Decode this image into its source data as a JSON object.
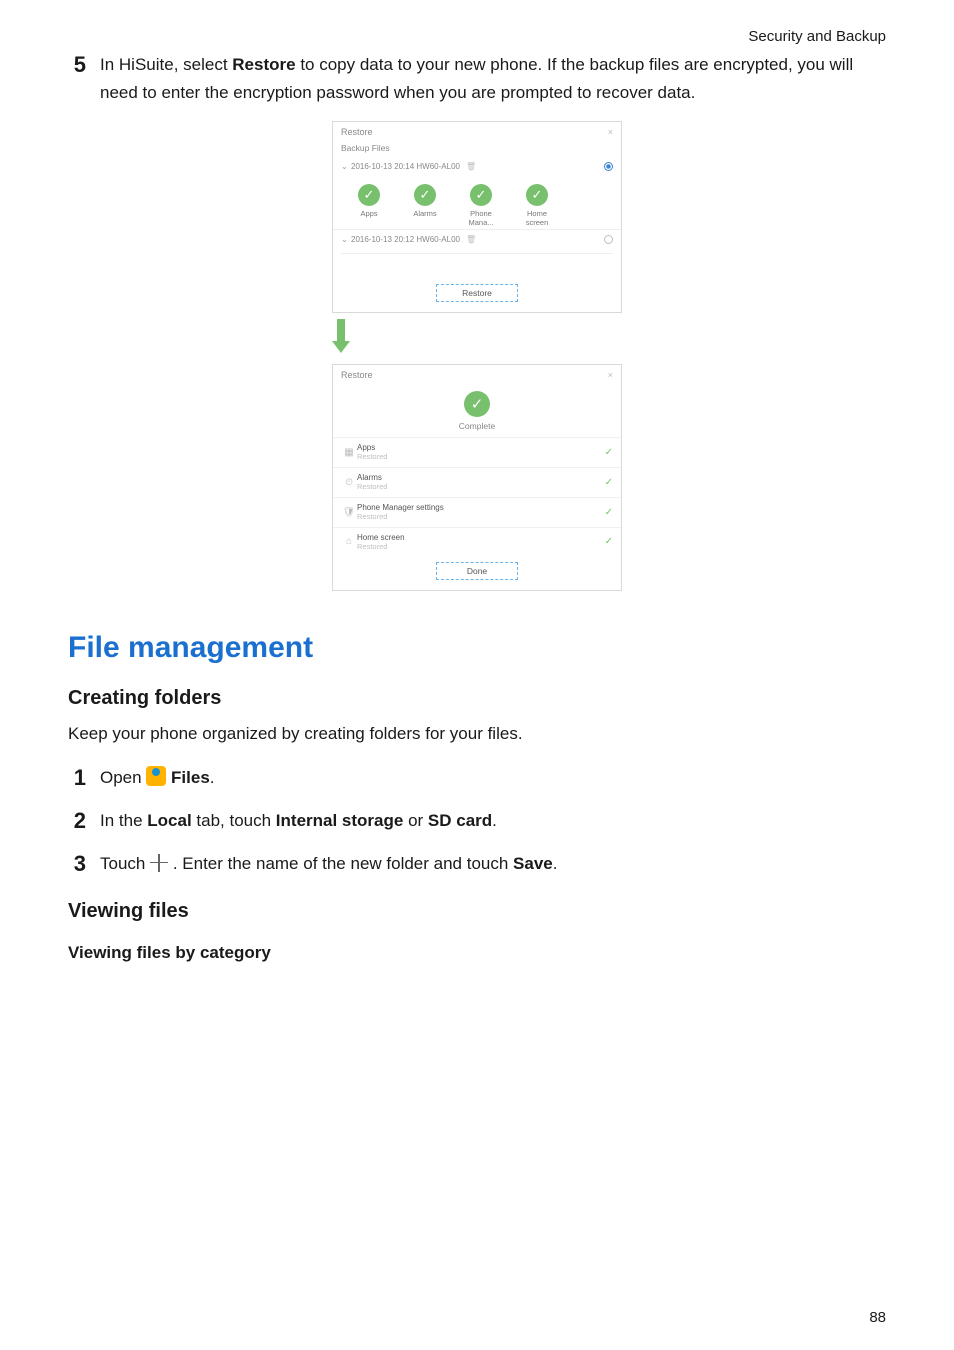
{
  "header": {
    "running": "Security and Backup"
  },
  "step5": {
    "num": "5",
    "para_html": "In HiSuite, select <strong>Restore</strong> to copy data to your new phone. If the backup files are encrypted, you will need to enter the encryption password when you are prompted to recover data."
  },
  "shot1": {
    "title": "Restore",
    "subhead": "Backup Files",
    "backup1_label": "2016-10-13 20:14 HW60-AL00",
    "backup2_label": "2016-10-13 20:12 HW60-AL00",
    "items": {
      "apps": "Apps",
      "alarms": "Alarms",
      "phone_mana": "Phone Mana...",
      "home_screen": "Home screen"
    },
    "button": "Restore"
  },
  "shot2": {
    "title": "Restore",
    "complete": "Complete",
    "rows": {
      "apps": {
        "name": "Apps",
        "status": "Restored"
      },
      "alarms": {
        "name": "Alarms",
        "status": "Restored"
      },
      "pms": {
        "name": "Phone Manager settings",
        "status": "Restored"
      },
      "home": {
        "name": "Home screen",
        "status": "Restored"
      }
    },
    "button": "Done"
  },
  "section": {
    "title": "File management"
  },
  "creating": {
    "heading": "Creating folders",
    "intro": "Keep your phone organized by creating folders for your files.",
    "step1_num": "1",
    "step1_prefix": "Open ",
    "step1_app": "Files",
    "step1_suffix": ".",
    "step2_num": "2",
    "step2_html": "In the <strong>Local</strong> tab, touch <strong>Internal storage</strong> or <strong>SD card</strong>.",
    "step3_num": "3",
    "step3_prefix": "Touch ",
    "step3_mid": " . Enter the name of the new folder and touch ",
    "step3_save": "Save",
    "step3_suffix": "."
  },
  "viewing": {
    "heading": "Viewing files",
    "sub": "Viewing files by category"
  },
  "footer": {
    "page": "88"
  }
}
